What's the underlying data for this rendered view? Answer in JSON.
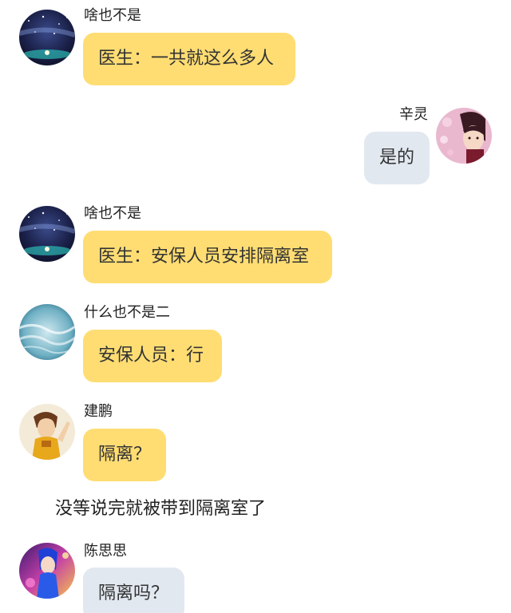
{
  "messages": [
    {
      "sender": "啥也不是",
      "text": "医生：一共就这么多人",
      "side": "left",
      "bubble_color": "#FFDD73"
    },
    {
      "sender": "辛灵",
      "text": "是的",
      "side": "right",
      "bubble_color": "#E2E8F0"
    },
    {
      "sender": "啥也不是",
      "text": "医生：安保人员安排隔离室",
      "side": "left",
      "bubble_color": "#FFDD73"
    },
    {
      "sender": "什么也不是二",
      "text": "安保人员：行",
      "side": "left",
      "bubble_color": "#FFDD73"
    },
    {
      "sender": "建鹏",
      "text": "隔离？",
      "side": "left",
      "bubble_color": "#FFDD73"
    },
    {
      "sender": "陈思思",
      "text": "隔离吗？",
      "side": "left",
      "bubble_color": "#E2E8F0"
    }
  ],
  "narration": "没等说完就被带到隔离室了",
  "avatars": [
    "starry-night-avatar",
    "anime-girl-avatar",
    "starry-night-avatar",
    "ocean-wave-avatar",
    "anime-boy-avatar",
    "anime-girl-blue-avatar"
  ]
}
